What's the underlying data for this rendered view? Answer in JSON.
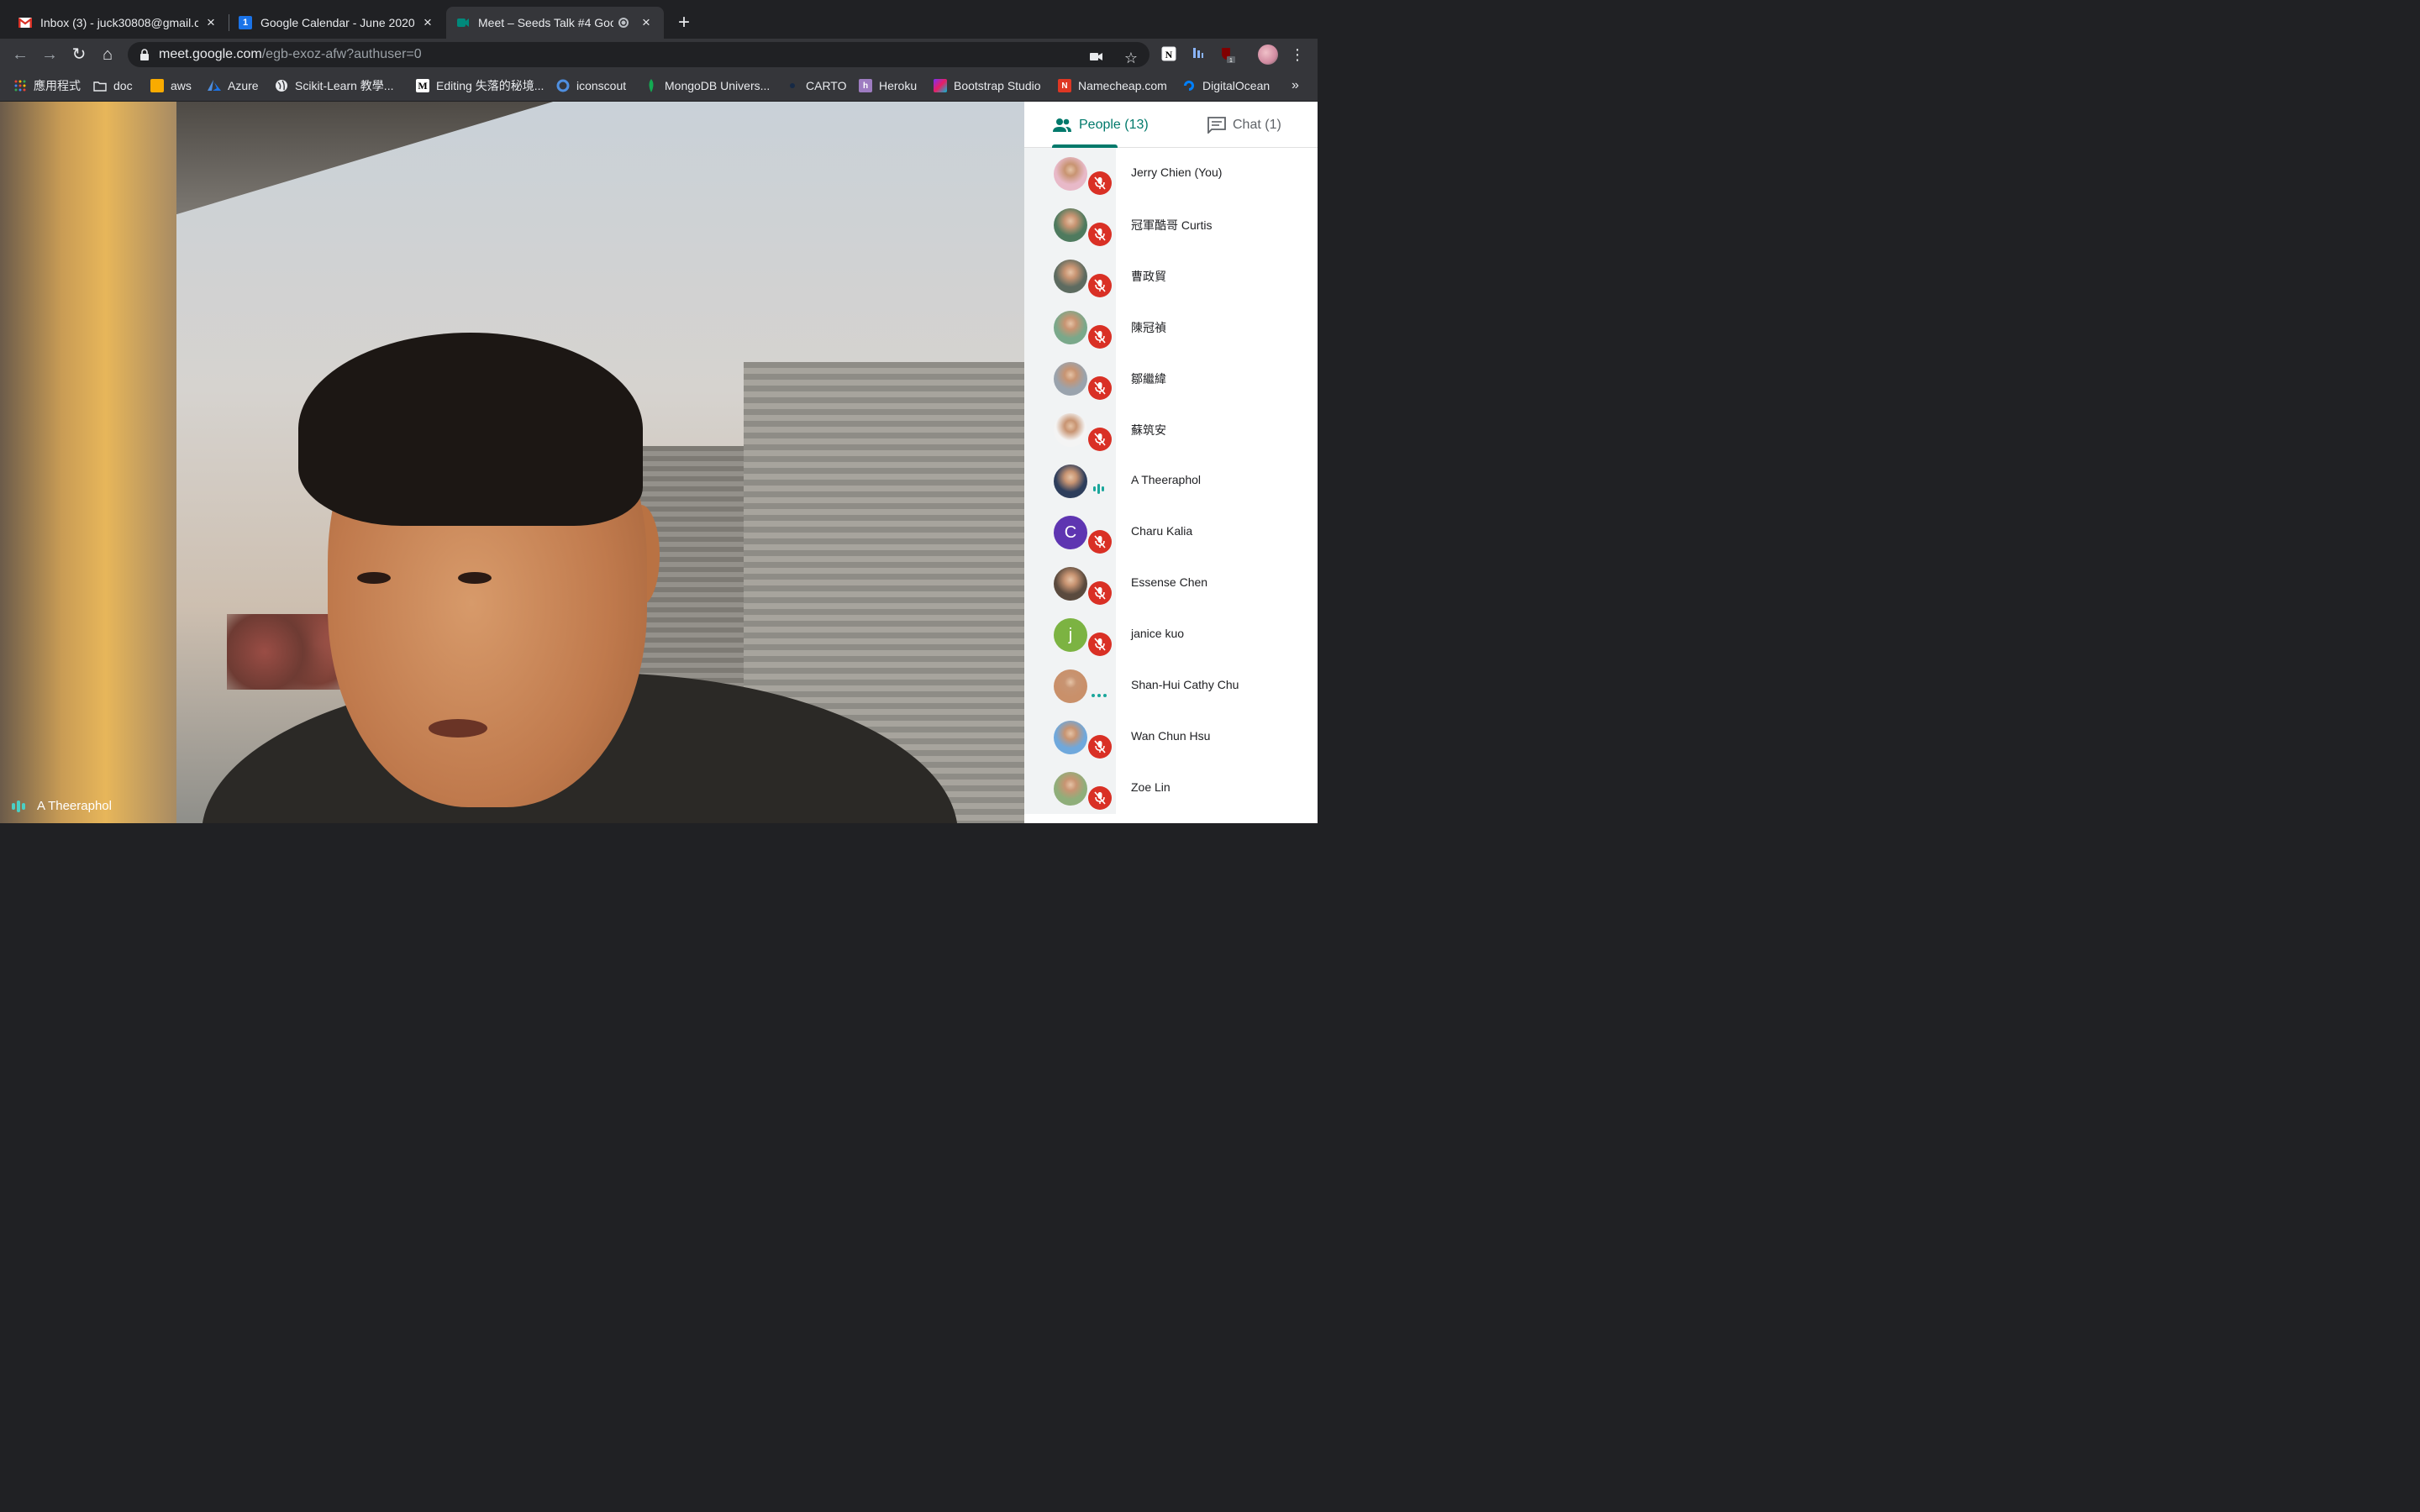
{
  "browser": {
    "tabs": [
      {
        "title": "Inbox (3) - juck30808@gmail.c",
        "favicon": "gmail-icon"
      },
      {
        "title": "Google Calendar - June 2020",
        "favicon": "calendar-icon"
      },
      {
        "title": "Meet – Seeds Talk #4 Goog",
        "favicon": "meet-icon"
      }
    ],
    "url_host": "meet.google.com",
    "url_path": "/egb-exoz-afw?authuser=0",
    "extension_badge": "1"
  },
  "bookmarks": [
    {
      "label": "應用程式",
      "icon": "apps-grid-icon"
    },
    {
      "label": "doc",
      "icon": "folder-icon"
    },
    {
      "label": "aws",
      "icon": "aws-icon"
    },
    {
      "label": "Azure",
      "icon": "azure-icon"
    },
    {
      "label": "Scikit-Learn 教學...",
      "icon": "globe-icon"
    },
    {
      "label": "Editing 失落的秘境...",
      "icon": "medium-icon"
    },
    {
      "label": "iconscout",
      "icon": "iconscout-icon"
    },
    {
      "label": "MongoDB Univers...",
      "icon": "mongodb-icon"
    },
    {
      "label": "CARTO",
      "icon": "carto-icon"
    },
    {
      "label": "Heroku",
      "icon": "heroku-icon"
    },
    {
      "label": "Bootstrap Studio",
      "icon": "bootstrap-icon"
    },
    {
      "label": "Namecheap.com",
      "icon": "namecheap-icon"
    },
    {
      "label": "DigitalOcean",
      "icon": "digitalocean-icon"
    }
  ],
  "video": {
    "speaker_name": "A Theeraphol"
  },
  "panel": {
    "people_tab": "People (13)",
    "chat_tab": "Chat (1)",
    "participants": [
      {
        "name": "Jerry Chien (You)",
        "status": "muted",
        "avatar_color": "#e8b9c8"
      },
      {
        "name": "冠軍酷哥 Curtis",
        "status": "muted",
        "avatar_color": "#4e7a5e"
      },
      {
        "name": "曹政貿",
        "status": "muted",
        "avatar_color": "#5d6b60"
      },
      {
        "name": "陳冠禎",
        "status": "muted",
        "avatar_color": "#7aa88a"
      },
      {
        "name": "鄒繼緯",
        "status": "muted",
        "avatar_color": "#9aa3ad"
      },
      {
        "name": "蘇筑安",
        "status": "muted",
        "avatar_color": "#f4f4f4"
      },
      {
        "name": "A Theeraphol",
        "status": "speaking",
        "avatar_color": "#2e3e5c"
      },
      {
        "name": "Charu Kalia",
        "status": "muted",
        "avatar_color": "#5e35b1",
        "initial": "C"
      },
      {
        "name": "Essense Chen",
        "status": "muted",
        "avatar_color": "#5a4a3e"
      },
      {
        "name": "janice kuo",
        "status": "muted",
        "avatar_color": "#7cb342",
        "initial": "j"
      },
      {
        "name": "Shan-Hui Cathy Chu",
        "status": "connecting",
        "avatar_color": "#c9906a"
      },
      {
        "name": "Wan Chun Hsu",
        "status": "muted",
        "avatar_color": "#6fa8dc"
      },
      {
        "name": "Zoe Lin",
        "status": "muted",
        "avatar_color": "#8fae7a"
      }
    ]
  }
}
